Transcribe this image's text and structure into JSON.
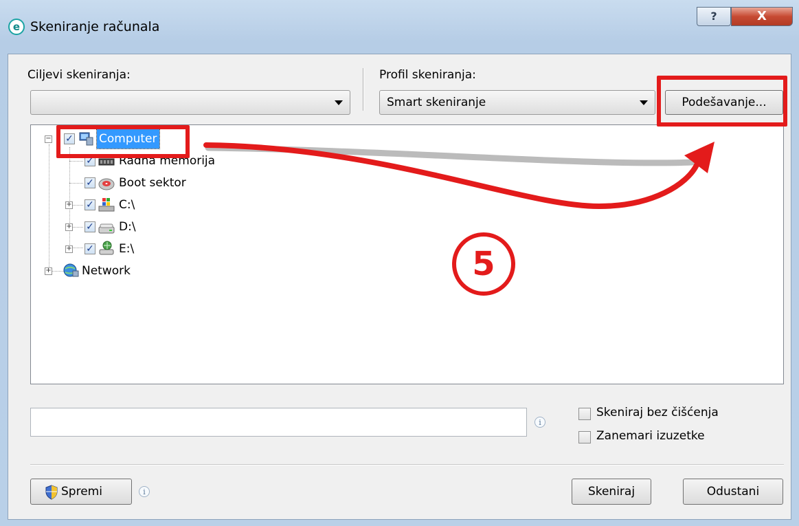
{
  "window": {
    "title": "Skeniranje računala",
    "app_icon": "e",
    "help_symbol": "?",
    "close_symbol": "X"
  },
  "targets": {
    "label": "Ciljevi skeniranja:",
    "selected": ""
  },
  "profile": {
    "label": "Profil skeniranja:",
    "selected": "Smart skeniranje",
    "settings_button": "Podešavanje..."
  },
  "tree": {
    "computer": "Computer",
    "children": [
      {
        "label": "Radna memorija",
        "icon": "memory-icon",
        "checked": true
      },
      {
        "label": "Boot sektor",
        "icon": "disk-icon",
        "checked": true
      },
      {
        "label": "C:\\",
        "icon": "windows-drive-icon",
        "checked": true
      },
      {
        "label": "D:\\",
        "icon": "drive-icon",
        "checked": true
      },
      {
        "label": "E:\\",
        "icon": "network-drive-icon",
        "checked": true
      }
    ],
    "network": "Network"
  },
  "path_input": {
    "value": ""
  },
  "options": {
    "no_cleaning": "Skeniraj bez čišćenja",
    "ignore_exclusions": "Zanemari izuzetke"
  },
  "buttons": {
    "save": "Spremi",
    "scan": "Skeniraj",
    "cancel": "Odustani"
  },
  "annotation": {
    "step_number": "5",
    "color": "#e31b1b"
  },
  "colors": {
    "selection": "#3399ff",
    "close_button": "#c74a33",
    "frame": "#b9d0e8"
  }
}
